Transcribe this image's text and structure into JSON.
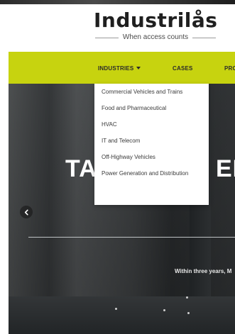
{
  "brand": {
    "logo_text": "Industrilås",
    "tagline": "When access counts"
  },
  "nav": {
    "items": [
      {
        "label": "INDUSTRIES",
        "has_dropdown": true,
        "open": true
      },
      {
        "label": "CASES"
      },
      {
        "label": "PRO"
      }
    ]
  },
  "industries_menu": {
    "items": [
      "Commercial Vehicles and Trains",
      "Food and Pharmaceutical",
      "HVAC",
      "IT and Telecom",
      "Off-Highway Vehicles",
      "Power Generation and Distribution"
    ]
  },
  "hero": {
    "headline_left": "TAK",
    "headline_right": "ER",
    "subtext": "Within three years, M"
  },
  "colors": {
    "nav_bg": "#c7d30f",
    "nav_text": "#2a2a2a",
    "dropdown_bg": "#ffffff",
    "hero_text": "#ffffff"
  },
  "icons": {
    "prev": "chevron-left-icon",
    "dropdown": "caret-down-icon"
  }
}
